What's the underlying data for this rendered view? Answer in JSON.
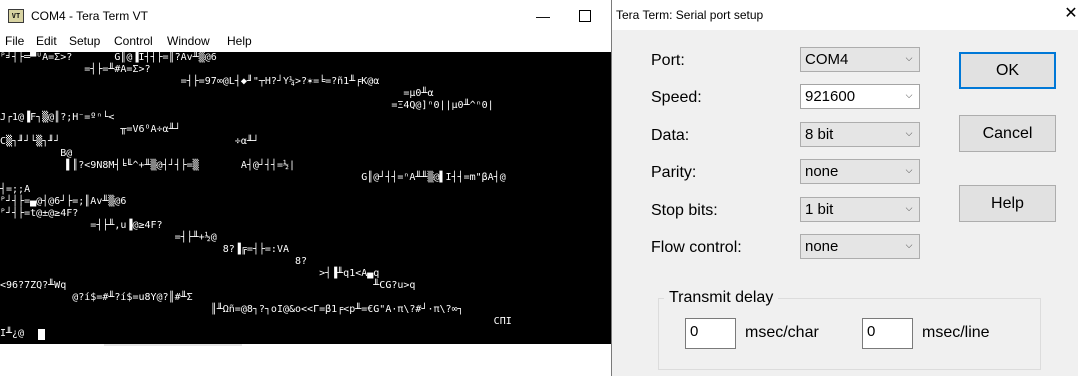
{
  "terminal_window": {
    "title": "COM4 - Tera Term VT",
    "app_icon_text": "VT",
    "menu": [
      "File",
      "Edit",
      "Setup",
      "Control",
      "Window",
      "Help"
    ],
    "screen_lines": [
      "ᴾ╛┤├═▀ᵁA=Σ>?       G║@▐I┤┤├=║?Av╨▒@6",
      "              =┤├=╨#A=Σ>?",
      "                              =┤├=97∞@L┤◆╜\"┬H?┘Y¼>?✶=╘=?ñ1╨╒K@α",
      "                                                                   =μ0╨α",
      "                                                                 =Ξ4Q@]ⁿ0||μ0╨^ⁿ0|",
      "J┌1@▐F┐▒@║?;H⁻=ºⁿ└<",
      "                    ╥=V6ᴼA÷α╨┘",
      "C▒┐╜┘└▒┐╜┘                             ÷α╨┘",
      "          B@",
      "           ▌║?<9N8M┤╘╙^+╨▒@┤┘┤├=▒       A┤@┘┤┤=½|",
      "                                                            G║@┘┤┤=ⁿA╨╨▒@▌I┤┤=m\"βA┤@",
      "┤=;;A",
      "ᴾ┘┤├=▄@┤@6┘├=;║Av╨▒@6",
      "ᴾ┘┤├=t@±@≥4F?",
      "               =┤├╨,u▐@≥4F?",
      "                             =┤├╨+½@",
      "                                     8?▐╔=┤├=:VA",
      "                                                 8?",
      "                                                     >┤▐╨q1<A▄q",
      "<96?7ZQ?╨Wq                                                   ╨CG?u>q",
      "            @?í$=#╨?í$=u8Y@?║#╨Σ",
      "                                   ║╨Ωñ=@8┐?┐oI@&o<<Γ=β1╒<p╨=€G\"A·π\\?#┘·π\\?∞┐",
      "                                                                                  CΠI",
      "I╨¿@"
    ]
  },
  "dialog": {
    "title": "Tera Term: Serial port setup",
    "fields": {
      "port": {
        "label": "Port:",
        "value": "COM4"
      },
      "speed": {
        "label": "Speed:",
        "value": "921600"
      },
      "data": {
        "label": "Data:",
        "value": "8 bit"
      },
      "parity": {
        "label": "Parity:",
        "value": "none"
      },
      "stop_bits": {
        "label": "Stop bits:",
        "value": "1 bit"
      },
      "flow_control": {
        "label": "Flow control:",
        "value": "none"
      }
    },
    "buttons": {
      "ok": "OK",
      "cancel": "Cancel",
      "help": "Help"
    },
    "transmit_delay": {
      "legend": "Transmit delay",
      "char_value": "0",
      "char_unit": "msec/char",
      "line_value": "0",
      "line_unit": "msec/line"
    }
  },
  "icons": {
    "app": "tera-term-icon",
    "minimize": "minimize-icon",
    "maximize": "maximize-icon",
    "close": "close-icon",
    "dropdown": "chevron-down-icon"
  },
  "colors": {
    "terminal_background": "#000000",
    "terminal_text": "#ffffff",
    "dialog_background": "#f0f0f0",
    "default_button_border": "#0078d7"
  }
}
